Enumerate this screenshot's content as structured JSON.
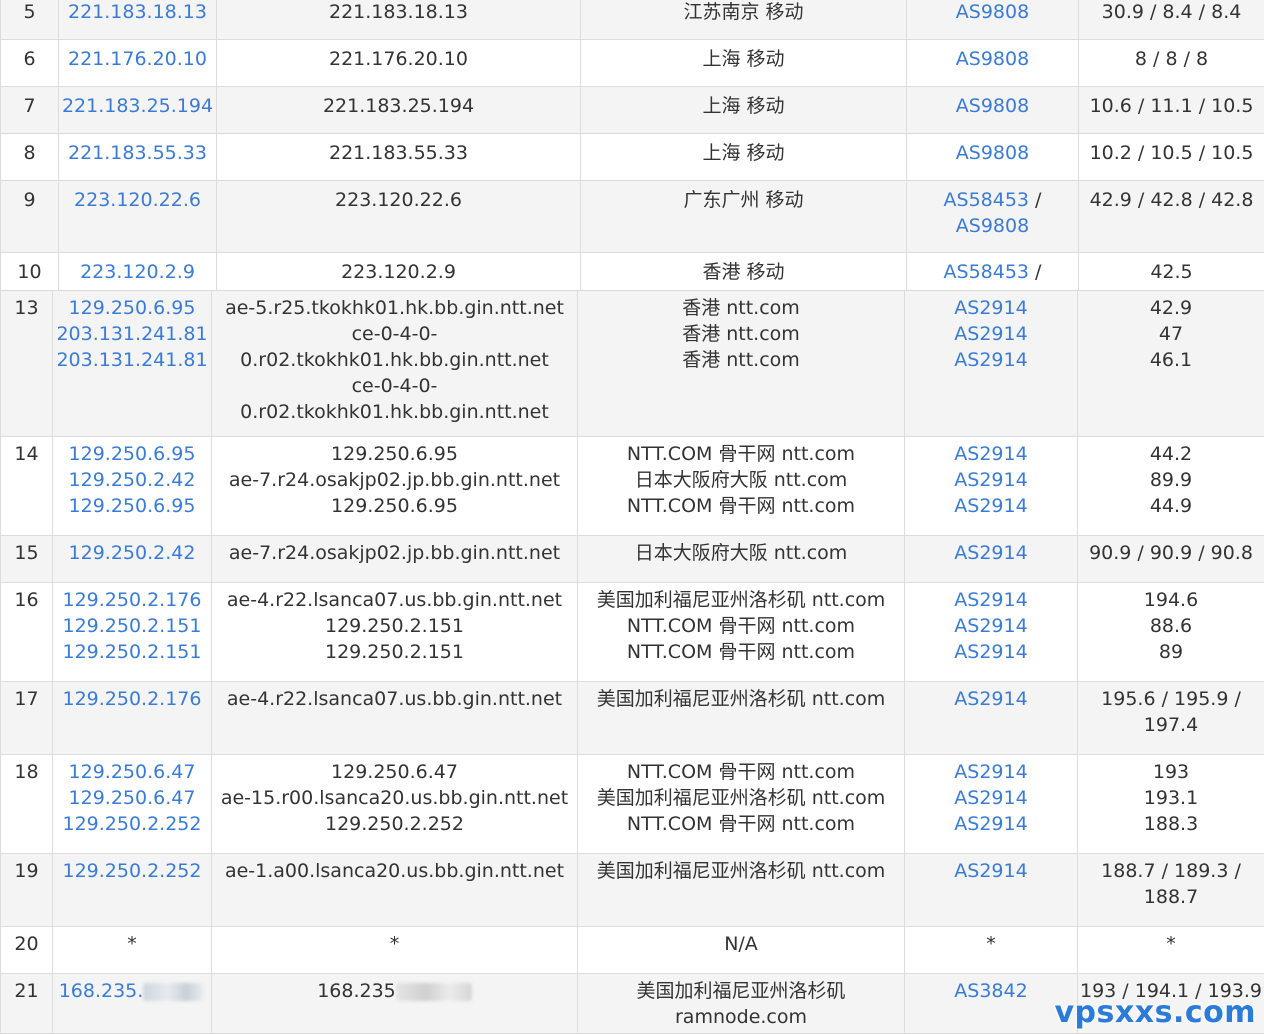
{
  "table_top": {
    "rows": [
      {
        "hop": "5",
        "ip": "221.183.18.13",
        "host": "221.183.18.13",
        "geo": "江苏南京 移动",
        "asn": [
          "AS9808"
        ],
        "rtt": "30.9 / 8.4 / 8.4"
      },
      {
        "hop": "6",
        "ip": "221.176.20.10",
        "host": "221.176.20.10",
        "geo": "上海 移动",
        "asn": [
          "AS9808"
        ],
        "rtt": "8 / 8 / 8"
      },
      {
        "hop": "7",
        "ip": "221.183.25.194",
        "host": "221.183.25.194",
        "geo": "上海 移动",
        "asn": [
          "AS9808"
        ],
        "rtt": "10.6 / 11.1 / 10.5"
      },
      {
        "hop": "8",
        "ip": "221.183.55.33",
        "host": "221.183.55.33",
        "geo": "上海 移动",
        "asn": [
          "AS9808"
        ],
        "rtt": "10.2 / 10.5 / 10.5"
      },
      {
        "hop": "9",
        "ip": "223.120.22.6",
        "host": "223.120.22.6",
        "geo": "广东广州 移动",
        "asn": [
          "AS58453",
          "AS9808"
        ],
        "rtt": "42.9 / 42.8 / 42.8"
      },
      {
        "hop": "10",
        "ip": "223.120.2.9",
        "host": "223.120.2.9",
        "geo": "香港 移动",
        "asn": [
          "AS58453"
        ],
        "rtt": "42.5"
      }
    ]
  },
  "table_bottom": {
    "rows": [
      {
        "hop": "13",
        "ips": [
          "129.250.6.95",
          "203.131.241.81",
          "203.131.241.81"
        ],
        "hosts": [
          "ae-5.r25.tkokhk01.hk.bb.gin.ntt.net",
          "ce-0-4-0-",
          "0.r02.tkokhk01.hk.bb.gin.ntt.net",
          "ce-0-4-0-",
          "0.r02.tkokhk01.hk.bb.gin.ntt.net"
        ],
        "geos": [
          "香港 ntt.com",
          "香港 ntt.com",
          "香港 ntt.com"
        ],
        "asns": [
          "AS2914",
          "AS2914",
          "AS2914"
        ],
        "rtts": [
          "42.9",
          "47",
          "46.1"
        ]
      },
      {
        "hop": "14",
        "ips": [
          "129.250.6.95",
          "129.250.2.42",
          "129.250.6.95"
        ],
        "hosts": [
          "129.250.6.95",
          "ae-7.r24.osakjp02.jp.bb.gin.ntt.net",
          "129.250.6.95"
        ],
        "geos": [
          "NTT.COM 骨干网 ntt.com",
          "日本大阪府大阪 ntt.com",
          "NTT.COM 骨干网 ntt.com"
        ],
        "asns": [
          "AS2914",
          "AS2914",
          "AS2914"
        ],
        "rtts": [
          "44.2",
          "89.9",
          "44.9"
        ]
      },
      {
        "hop": "15",
        "ips": [
          "129.250.2.42"
        ],
        "hosts": [
          "ae-7.r24.osakjp02.jp.bb.gin.ntt.net"
        ],
        "geos": [
          "日本大阪府大阪 ntt.com"
        ],
        "asns": [
          "AS2914"
        ],
        "rtts": [
          "90.9 / 90.9 / 90.8"
        ]
      },
      {
        "hop": "16",
        "ips": [
          "129.250.2.176",
          "129.250.2.151",
          "129.250.2.151"
        ],
        "hosts": [
          "ae-4.r22.lsanca07.us.bb.gin.ntt.net",
          "129.250.2.151",
          "129.250.2.151"
        ],
        "geos": [
          "美国加利福尼亚州洛杉矶 ntt.com",
          "NTT.COM 骨干网 ntt.com",
          "NTT.COM 骨干网 ntt.com"
        ],
        "asns": [
          "AS2914",
          "AS2914",
          "AS2914"
        ],
        "rtts": [
          "194.6",
          "88.6",
          "89"
        ]
      },
      {
        "hop": "17",
        "ips": [
          "129.250.2.176"
        ],
        "hosts": [
          "ae-4.r22.lsanca07.us.bb.gin.ntt.net"
        ],
        "geos": [
          "美国加利福尼亚州洛杉矶 ntt.com"
        ],
        "asns": [
          "AS2914"
        ],
        "rtts": [
          "195.6 / 195.9 /",
          "197.4"
        ]
      },
      {
        "hop": "18",
        "ips": [
          "129.250.6.47",
          "129.250.6.47",
          "129.250.2.252"
        ],
        "hosts": [
          "129.250.6.47",
          "ae-15.r00.lsanca20.us.bb.gin.ntt.net",
          "129.250.2.252"
        ],
        "geos": [
          "NTT.COM 骨干网 ntt.com",
          "美国加利福尼亚州洛杉矶 ntt.com",
          "NTT.COM 骨干网 ntt.com"
        ],
        "asns": [
          "AS2914",
          "AS2914",
          "AS2914"
        ],
        "rtts": [
          "193",
          "193.1",
          "188.3"
        ]
      },
      {
        "hop": "19",
        "ips": [
          "129.250.2.252"
        ],
        "hosts": [
          "ae-1.a00.lsanca20.us.bb.gin.ntt.net"
        ],
        "geos": [
          "美国加利福尼亚州洛杉矶 ntt.com"
        ],
        "asns": [
          "AS2914"
        ],
        "rtts": [
          "188.7 / 189.3 /",
          "188.7"
        ]
      },
      {
        "hop": "20",
        "ips": [
          "*"
        ],
        "ip_plain": true,
        "hosts": [
          "*"
        ],
        "geos": [
          "N/A"
        ],
        "asns": [
          "*"
        ],
        "asn_plain": true,
        "rtts": [
          "*"
        ]
      },
      {
        "hop": "21",
        "ips": [
          "168.235."
        ],
        "ip_blur": true,
        "hosts": [
          "168.235"
        ],
        "host_blur": true,
        "geos": [
          "美国加利福尼亚州洛杉矶",
          "ramnode.com"
        ],
        "asns": [
          "AS3842"
        ],
        "rtts": [
          "193 / 194.1 / 193.9"
        ]
      }
    ]
  },
  "watermark": "vpsxxs.com"
}
